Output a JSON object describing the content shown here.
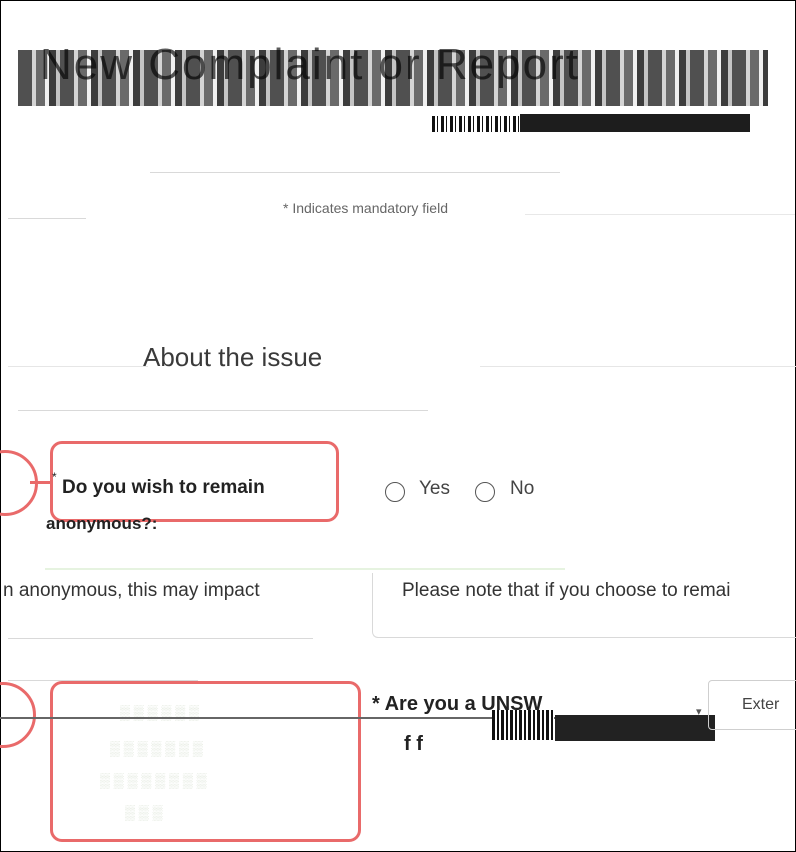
{
  "header": {
    "page_title": "New Complaint or Report"
  },
  "form": {
    "mandatory_note": "* Indicates mandatory field",
    "section_title": "About the issue",
    "anonymous_question": {
      "asterisk": "*",
      "line1": "Do you wish to remain",
      "line2": "anonymous?:",
      "options": [
        "Yes",
        "No"
      ]
    },
    "anonymous_note_left": "n anonymous, this may impact",
    "anonymous_note_right": "Please note that if you choose to remai",
    "unsw_question": {
      "label": "* Are you a UNSW",
      "label_line2": "f f",
      "select_value": "Exter"
    }
  },
  "colors": {
    "callout": "#e96a6a",
    "divider": "#d9d9d9"
  }
}
